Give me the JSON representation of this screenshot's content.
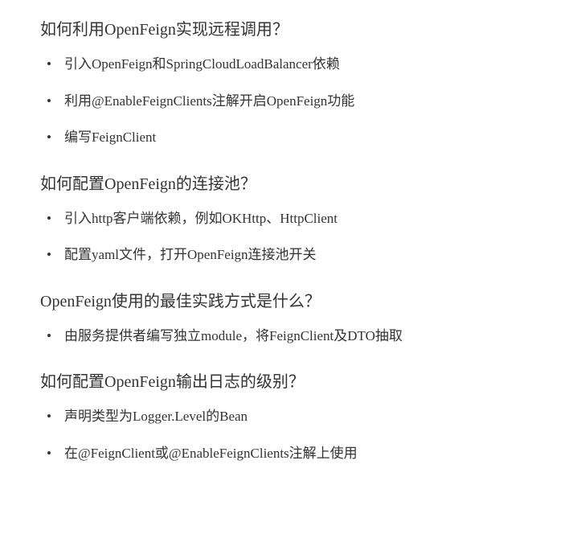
{
  "sections": [
    {
      "heading": "如何利用OpenFeign实现远程调用？",
      "items": [
        "引入OpenFeign和SpringCloudLoadBalancer依赖",
        "利用@EnableFeignClients注解开启OpenFeign功能",
        "编写FeignClient"
      ]
    },
    {
      "heading": "如何配置OpenFeign的连接池？",
      "items": [
        "引入http客户端依赖，例如OKHttp、HttpClient",
        "配置yaml文件，打开OpenFeign连接池开关"
      ]
    },
    {
      "heading": "OpenFeign使用的最佳实践方式是什么？",
      "items": [
        "由服务提供者编写独立module，将FeignClient及DTO抽取"
      ]
    },
    {
      "heading": "如何配置OpenFeign输出日志的级别？",
      "items": [
        "声明类型为Logger.Level的Bean",
        "在@FeignClient或@EnableFeignClients注解上使用"
      ]
    }
  ]
}
